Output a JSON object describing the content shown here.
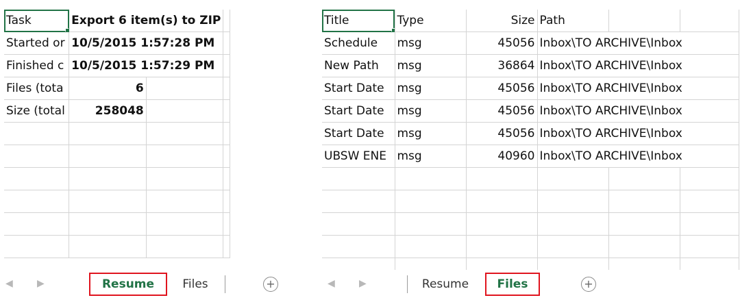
{
  "left": {
    "rows": [
      [
        "Task",
        "Export 6 item(s) to ZIP",
        "",
        ""
      ],
      [
        "Started or",
        "10/5/2015 1:57:28 PM",
        "",
        ""
      ],
      [
        "Finished c",
        "10/5/2015 1:57:29 PM",
        "",
        ""
      ],
      [
        "Files (tota",
        "6",
        "",
        ""
      ],
      [
        "Size (total",
        "258048",
        "",
        ""
      ]
    ],
    "tabs": {
      "resume": "Resume",
      "files": "Files",
      "active": "Resume"
    }
  },
  "right": {
    "header": [
      "Title",
      "Type",
      "Size",
      "Path"
    ],
    "rows": [
      [
        "Schedule",
        "msg",
        "45056",
        "Inbox\\TO ARCHIVE\\Inbox"
      ],
      [
        "New Path",
        "msg",
        "36864",
        "Inbox\\TO ARCHIVE\\Inbox"
      ],
      [
        "Start Date",
        "msg",
        "45056",
        "Inbox\\TO ARCHIVE\\Inbox"
      ],
      [
        "Start Date",
        "msg",
        "45056",
        "Inbox\\TO ARCHIVE\\Inbox"
      ],
      [
        "Start Date",
        "msg",
        "45056",
        "Inbox\\TO ARCHIVE\\Inbox"
      ],
      [
        "UBSW ENE",
        "msg",
        "40960",
        "Inbox\\TO ARCHIVE\\Inbox"
      ]
    ],
    "tabs": {
      "resume": "Resume",
      "files": "Files",
      "active": "Files"
    }
  },
  "colors": {
    "accent": "#217346",
    "highlight": "#e0141e",
    "gridline": "#d4d4d4"
  },
  "icons": {
    "prev": "chevron-left-icon",
    "next": "chevron-right-icon",
    "add": "plus-circle-icon"
  }
}
